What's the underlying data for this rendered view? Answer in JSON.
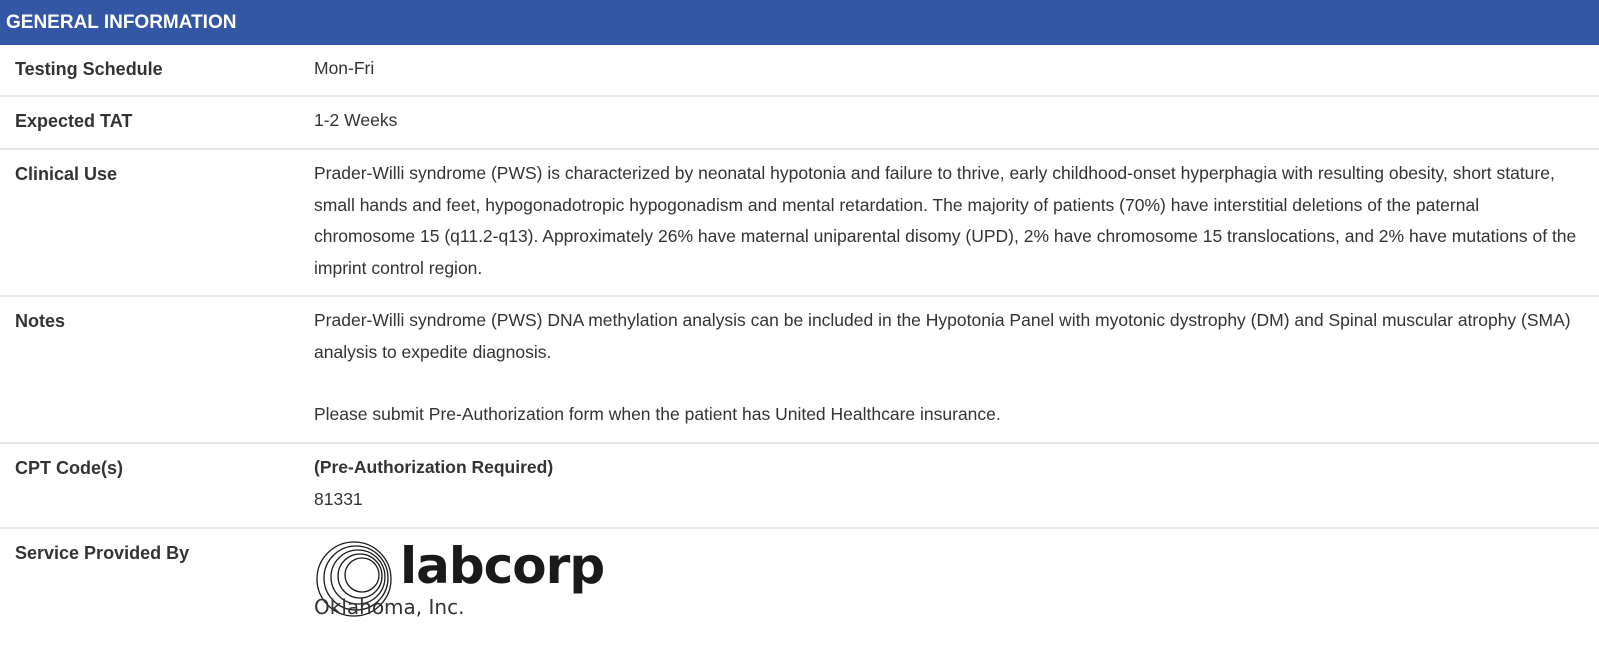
{
  "header": {
    "title": "GENERAL INFORMATION"
  },
  "rows": {
    "testing_schedule": {
      "label": "Testing Schedule",
      "value": "Mon-Fri"
    },
    "expected_tat": {
      "label": "Expected TAT",
      "value": "1-2 Weeks"
    },
    "clinical_use": {
      "label": "Clinical Use",
      "value": "Prader-Willi syndrome (PWS) is characterized by neonatal hypotonia and failure to thrive, early childhood-onset hyperphagia with resulting obesity, short stature, small hands and feet, hypogonadotropic hypogonadism and mental retardation. The majority of patients (70%) have interstitial deletions of the paternal chromosome 15 (q11.2-q13). Approximately 26% have maternal uniparental disomy (UPD), 2% have chromosome 15 translocations, and 2% have mutations of the imprint control region."
    },
    "notes": {
      "label": "Notes",
      "paragraph1": "Prader-Willi syndrome (PWS) DNA methylation analysis can be included in the Hypotonia Panel with myotonic dystrophy (DM) and Spinal muscular atrophy (SMA) analysis to expedite diagnosis.",
      "paragraph2": "Please submit Pre-Authorization form when the patient has United Healthcare insurance."
    },
    "cpt_codes": {
      "label": "CPT Code(s)",
      "note": "(Pre-Authorization Required)",
      "code": "81331"
    },
    "service_provider": {
      "label": "Service Provided By",
      "logo_word": "labcorp",
      "logo_subtitle": "Oklahoma, Inc."
    }
  },
  "colors": {
    "header_bg": "#3457a5",
    "header_text": "#ffffff",
    "body_text": "#333333",
    "divider": "#e6e6e6"
  },
  "icons": {
    "logo_mark": "labcorp-concentric-circles-icon"
  }
}
